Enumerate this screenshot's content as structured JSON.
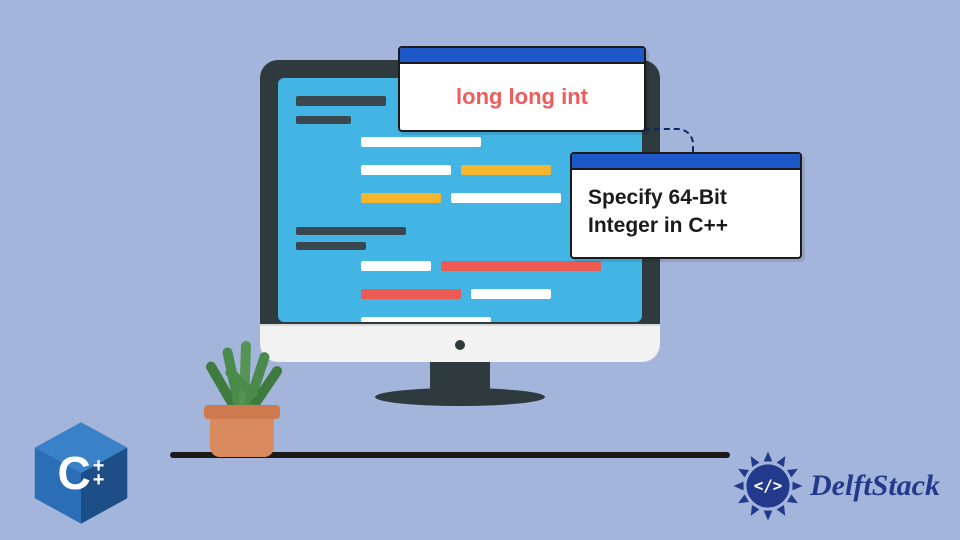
{
  "background_color": "#a4b5db",
  "callouts": {
    "code": {
      "text": "long long int",
      "color": "#f05c5c"
    },
    "title": {
      "line1": "Specify 64-Bit",
      "line2": "Integer in C++"
    }
  },
  "logos": {
    "cpp": {
      "letter": "C",
      "plus": "++",
      "fill_light": "#2a6fb5",
      "fill_dark": "#1d4e86"
    },
    "delftstack": {
      "text": "DelftStack",
      "color": "#233a8c"
    }
  }
}
